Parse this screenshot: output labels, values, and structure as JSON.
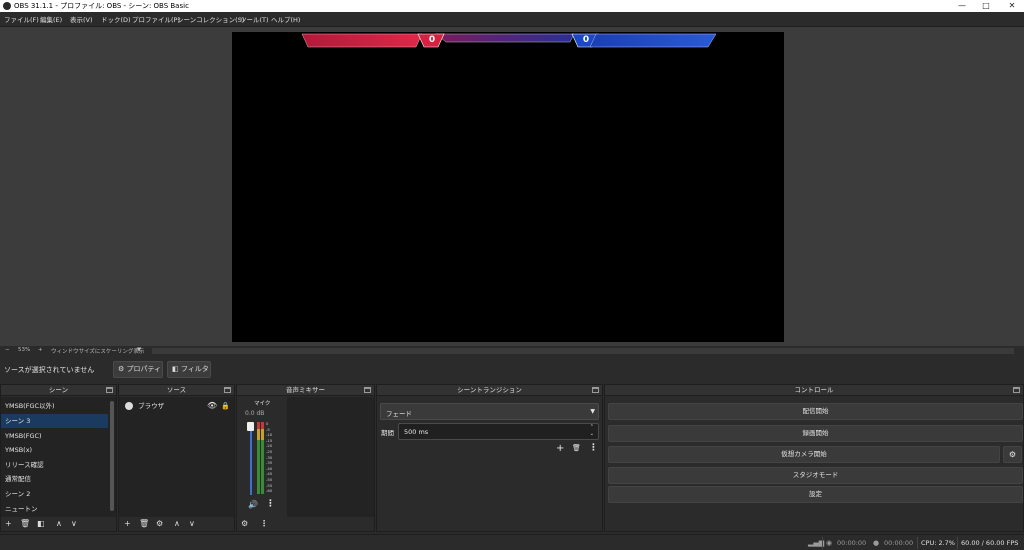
{
  "window": {
    "title": "OBS 31.1.1 - プロファイル: OBS - シーン: OBS Basic",
    "minimize": "—",
    "maximize": "□",
    "close": "✕"
  },
  "menu": [
    "ファイル(F)",
    "編集(E)",
    "表示(V)",
    "ドック(D)",
    "プロファイル(P)",
    "シーンコレクション(S)",
    "ツール(T)",
    "ヘルプ(H)"
  ],
  "scoreboard": {
    "left_score": "0",
    "right_score": "0",
    "left_color": "#c0203a",
    "right_color": "#1f4fc4"
  },
  "preview_bar": {
    "minus": "−",
    "zoom": "53%",
    "plus": "+",
    "scale_mode": "ウィンドウサイズにスケーリング表示"
  },
  "source_toolbar": {
    "message": "ソースが選択されていません",
    "properties": "プロパティ",
    "filters": "フィルタ"
  },
  "scenes": {
    "title": "シーン",
    "items": [
      "YMSB(FGC以外)",
      "シーン 3",
      "YMSB(FGC)",
      "YMSB(x)",
      "リリース確認",
      "通常配信",
      "シーン 2",
      "ニュートン"
    ],
    "selected": "シーン 3"
  },
  "sources": {
    "title": "ソース",
    "items": [
      {
        "name": "ブラウザ"
      }
    ]
  },
  "mixer": {
    "title": "音声ミキサー",
    "channel": "マイク",
    "db": "0.0 dB",
    "scale": [
      "0",
      "-5",
      "-10",
      "-15",
      "-20",
      "-25",
      "-30",
      "-35",
      "-40",
      "-45",
      "-50",
      "-55",
      "-60"
    ]
  },
  "transitions": {
    "title": "シーントランジション",
    "type": "フェード",
    "duration_label": "期間",
    "duration_value": "500 ms"
  },
  "controls": {
    "title": "コントロール",
    "start_streaming": "配信開始",
    "start_recording": "録画開始",
    "start_virtual_camera": "仮想カメラ開始",
    "studio_mode": "スタジオモード",
    "settings": "設定"
  },
  "status": {
    "stream_time": "00:00:00",
    "rec_time": "00:00:00",
    "cpu": "CPU: 2.7%",
    "fps": "60.00 / 60.00 FPS"
  }
}
